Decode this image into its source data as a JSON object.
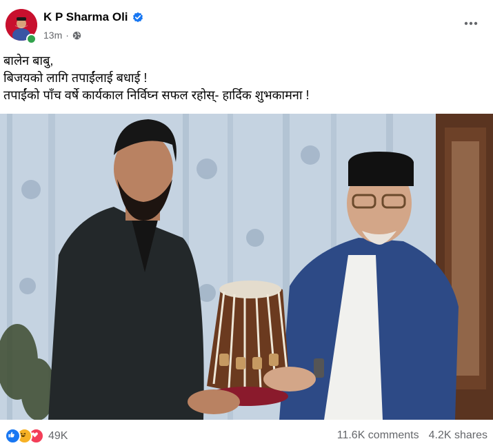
{
  "post": {
    "author_name": "K P Sharma Oli",
    "time": "13m",
    "separator": "·",
    "text_lines": [
      "बालेन बाबु,",
      "बिजयको लागि तपाईंलाई बधाई !",
      "तपाईंको पाँच वर्षे कार्यकाल निर्विघ्न सफल रहोस्- हार्दिक शुभकामना !"
    ]
  },
  "icons": {
    "verified": "verified-badge-icon",
    "privacy": "globe-icon",
    "more": "more-options-icon",
    "reactions": [
      "like-reaction-icon",
      "haha-reaction-icon",
      "love-reaction-icon"
    ]
  },
  "footer": {
    "reactions_count": "49K",
    "comments": "11.6K comments",
    "shares": "4.2K shares"
  },
  "colors": {
    "accent": "#1877f2",
    "secondary_text": "#65676b",
    "online": "#31a24c"
  }
}
